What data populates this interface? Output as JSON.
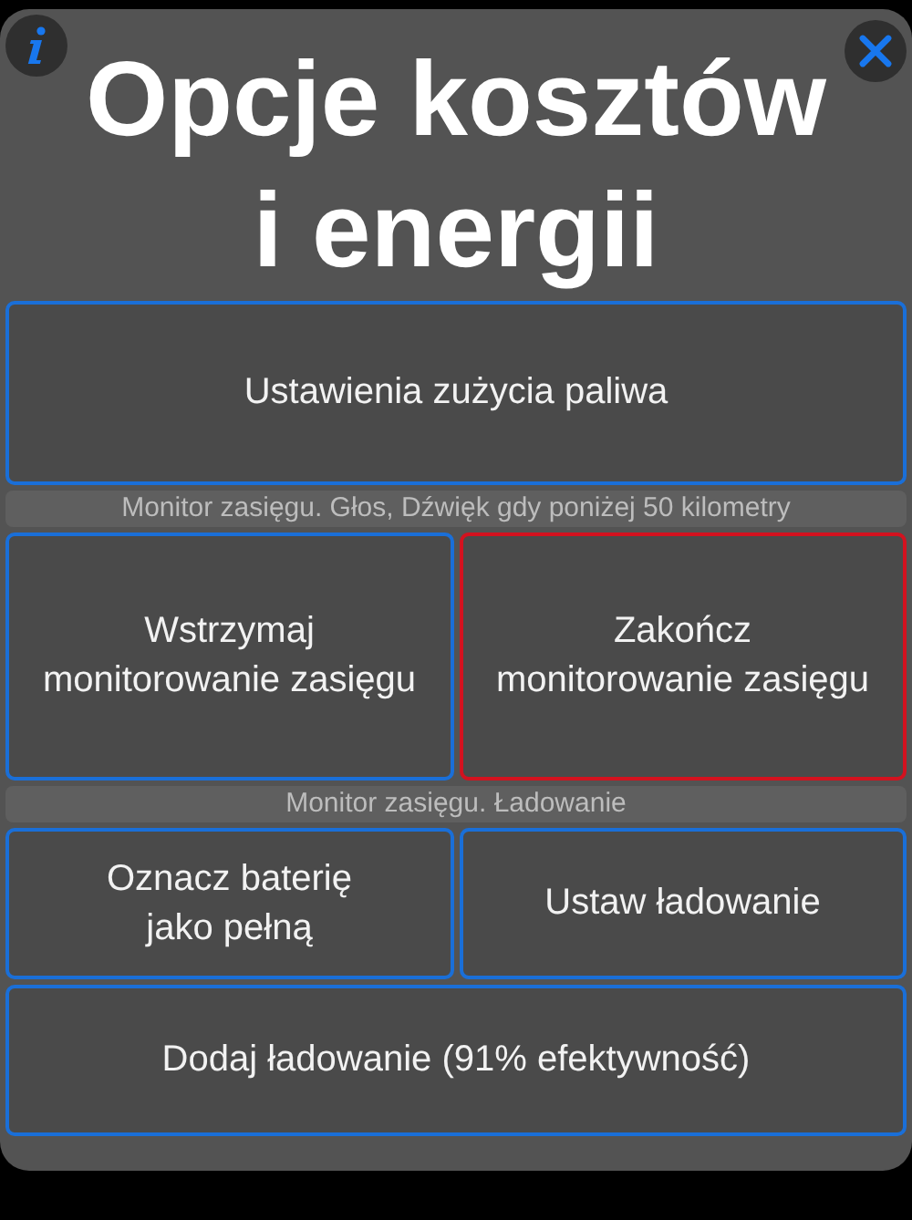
{
  "title_lines": [
    "Opcje kosztów",
    "i energii"
  ],
  "rows": [
    {
      "kind": "buttons",
      "buttons": [
        {
          "label": "Ustawienia zużycia paliwa",
          "color": "#1a6fd8"
        }
      ]
    },
    {
      "kind": "caption",
      "text": "Monitor zasięgu. Głos, Dźwięk gdy poniżej 50 kilometry"
    },
    {
      "kind": "buttons",
      "buttons": [
        {
          "label": "Wstrzymaj\nmonitorowanie zasięgu",
          "color": "#1a6fd8"
        },
        {
          "label": "Zakończ\nmonitorowanie zasięgu",
          "color": "#d3121f"
        }
      ]
    },
    {
      "kind": "caption",
      "text": "Monitor zasięgu. Ładowanie"
    },
    {
      "kind": "buttons",
      "buttons": [
        {
          "label": "Oznacz baterię\njako pełną",
          "color": "#1a6fd8"
        },
        {
          "label": "Ustaw ładowanie",
          "color": "#1a6fd8"
        }
      ]
    },
    {
      "kind": "buttons",
      "buttons": [
        {
          "label": "Dodaj ładowanie (91% efektywność)",
          "color": "#1a6fd8"
        }
      ]
    }
  ]
}
